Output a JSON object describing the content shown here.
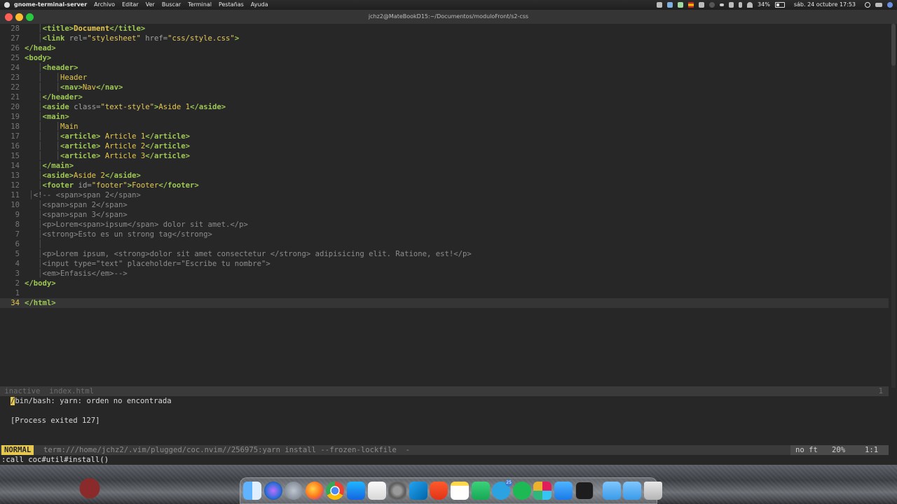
{
  "menubar": {
    "app_name": "gnome-terminal-server",
    "menus": [
      "Archivo",
      "Editar",
      "Ver",
      "Buscar",
      "Terminal",
      "Pestañas",
      "Ayuda"
    ],
    "battery": "34%",
    "datetime": "sáb. 24 octubre 17:53"
  },
  "window": {
    "title": "jchz2@MateBookD15:~/Documentos/moduloFront/s2-css"
  },
  "editor": {
    "cursor_line": "34",
    "lines": [
      {
        "num": "28",
        "text": "<title>Document</title>"
      },
      {
        "num": "27",
        "text": "<link rel=\"stylesheet\" href=\"css/style.css\">"
      },
      {
        "num": "26",
        "text": "</head>"
      },
      {
        "num": "25",
        "text": "<body>"
      },
      {
        "num": "24",
        "text": "<header>"
      },
      {
        "num": "23",
        "text": "Header"
      },
      {
        "num": "22",
        "text": "<nav>Nav</nav>"
      },
      {
        "num": "21",
        "text": "</header>"
      },
      {
        "num": "20",
        "text": "<aside class=\"text-style\">Aside 1</aside>"
      },
      {
        "num": "19",
        "text": "<main>"
      },
      {
        "num": "18",
        "text": "Main"
      },
      {
        "num": "17",
        "text": "<article> Article 1</article>"
      },
      {
        "num": "16",
        "text": "<article> Article 2</article>"
      },
      {
        "num": "15",
        "text": "<article> Article 3</article>"
      },
      {
        "num": "14",
        "text": "</main>"
      },
      {
        "num": "13",
        "text": "<aside>Aside 2</aside>"
      },
      {
        "num": "12",
        "text": "<footer id=\"footer\">Footer</footer>"
      },
      {
        "num": "11",
        "text": "<!-- <span>span 2</span>"
      },
      {
        "num": "10",
        "text": "<span>span 2</span>"
      },
      {
        "num": "9",
        "text": "<span>span 3</span>"
      },
      {
        "num": "8",
        "text": "<p>Lorem<span>ipsum</span> dolor sit amet.</p>"
      },
      {
        "num": "7",
        "text": "<strong>Esto es un strong tag</strong>"
      },
      {
        "num": "6",
        "text": ""
      },
      {
        "num": "5",
        "text": "<p>Lorem ipsum, <strong>dolor sit amet consectetur </strong> adipisicing elit. Ratione, est!</p>"
      },
      {
        "num": "4",
        "text": "<input type=\"text\" placeholder=\"Escribe tu nombre\">"
      },
      {
        "num": "3",
        "text": "<em>Enfasis</em>-->"
      },
      {
        "num": "2",
        "text": "</body>"
      },
      {
        "num": "1",
        "text": ""
      },
      {
        "num": "34",
        "text": "</html>"
      }
    ]
  },
  "inactive_status": {
    "mode": "inactive",
    "file": "index.html",
    "line": "1"
  },
  "terminal_output": {
    "error": "/bin/bash: yarn: orden no encontrada",
    "exit": "[Process exited 127]"
  },
  "active_status": {
    "mode": "NORMAL",
    "buffer": "term:///home/jchz2/.vim/plugged/coc.nvim//256975:yarn install --frozen-lockfile  -",
    "filetype": "no ft",
    "percent": "20%",
    "position": "1:1"
  },
  "command_line": ":call coc#util#install()",
  "dock": {
    "icons": [
      "finder-icon",
      "siri-icon",
      "launchpad-icon",
      "firefox-icon",
      "chrome-icon",
      "app-store-icon",
      "textedit-icon",
      "system-preferences-icon",
      "vscode-icon",
      "brave-icon",
      "notes-icon",
      "numbers-icon",
      "telegram-icon",
      "spotify-icon",
      "slack-icon",
      "mail-icon",
      "terminal-icon",
      "applications-folder-icon",
      "downloads-folder-icon",
      "trash-icon"
    ],
    "telegram_badge": "25"
  }
}
